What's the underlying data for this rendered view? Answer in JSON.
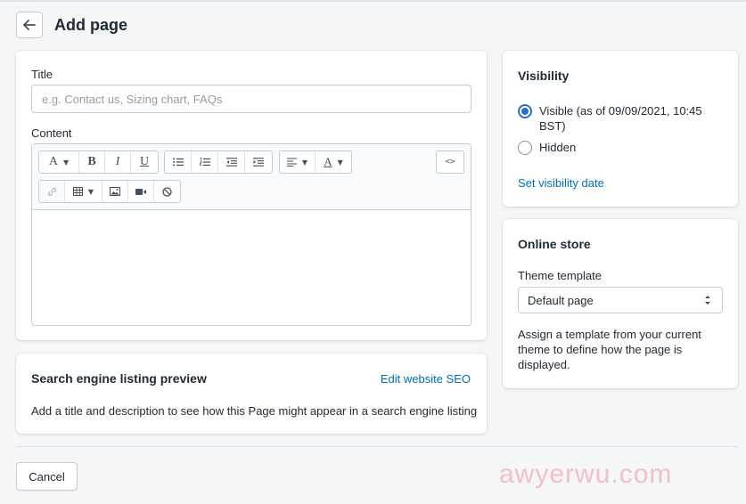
{
  "header": {
    "title": "Add page"
  },
  "main": {
    "title_label": "Title",
    "title_placeholder": "e.g. Contact us, Sizing chart, FAQs",
    "content_label": "Content",
    "toolbar": {
      "font_label": "A",
      "bold_label": "B",
      "italic_label": "I",
      "underline_label": "U",
      "color_label": "A",
      "code_label": "<>"
    }
  },
  "seo": {
    "title": "Search engine listing preview",
    "edit_link": "Edit website SEO",
    "description": "Add a title and description to see how this Page might appear in a search engine listing"
  },
  "visibility": {
    "heading": "Visibility",
    "visible_label": "Visible (as of 09/09/2021, 10:45 BST)",
    "hidden_label": "Hidden",
    "set_date_link": "Set visibility date",
    "selected": "visible"
  },
  "online_store": {
    "heading": "Online store",
    "template_label": "Theme template",
    "template_value": "Default page",
    "help_text": "Assign a template from your current theme to define how the page is displayed."
  },
  "footer": {
    "cancel_label": "Cancel"
  },
  "watermark": {
    "text": "awyerwu.com"
  },
  "colors": {
    "link": "#006fbb",
    "radio_accent": "#2c6ecb",
    "background": "#f4f6f8"
  }
}
